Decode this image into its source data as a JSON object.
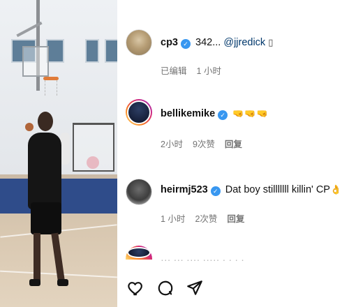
{
  "comments": [
    {
      "username": "cp3",
      "verified": true,
      "text": "342...",
      "mention": "@jjredick",
      "trailing": "▯",
      "meta": {
        "edited": "已编辑",
        "time": "1 小时"
      },
      "avatar": "avatar-cp3"
    },
    {
      "username": "bellikemike",
      "verified": true,
      "text": "🤜🤜🤜",
      "meta": {
        "time": "2小时",
        "likes": "9次赞",
        "reply": "回复"
      },
      "avatar": "avatar-bellikemike"
    },
    {
      "username": "heirmj523",
      "verified": true,
      "text": "Dat boy stilllllll killin' CP",
      "trailing": "👌",
      "meta": {
        "time": "1 小时",
        "likes": "2次赞",
        "reply": "回复"
      },
      "avatar": "avatar-heirmj523"
    }
  ],
  "partial_comment_text": "··· ··· ···· ····· · · · ·"
}
